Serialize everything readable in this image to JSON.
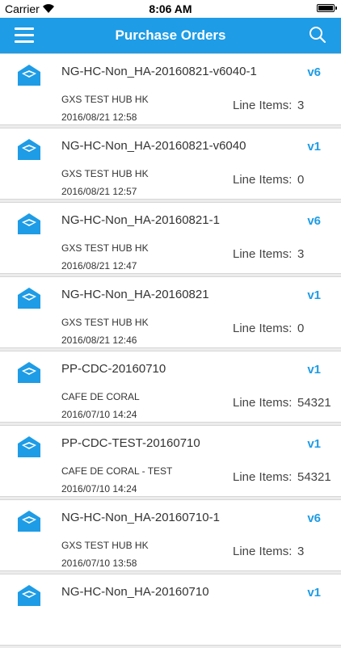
{
  "status_bar": {
    "carrier": "Carrier",
    "time": "8:06 AM"
  },
  "nav": {
    "title": "Purchase Orders",
    "menu_icon": "hamburger-menu-icon",
    "search_icon": "search-icon"
  },
  "theme": {
    "accent": "#1e9ce6",
    "background": "#ececec"
  },
  "line_items_label": "Line Items:",
  "orders": [
    {
      "name": "NG-HC-Non_HA-20160821-v6040-1",
      "version": "v6",
      "partner": "GXS TEST HUB HK",
      "date": "2016/08/21 12:58",
      "line_items": "3"
    },
    {
      "name": "NG-HC-Non_HA-20160821-v6040",
      "version": "v1",
      "partner": "GXS TEST HUB HK",
      "date": "2016/08/21 12:57",
      "line_items": "0"
    },
    {
      "name": "NG-HC-Non_HA-20160821-1",
      "version": "v6",
      "partner": "GXS TEST HUB HK",
      "date": "2016/08/21 12:47",
      "line_items": "3"
    },
    {
      "name": "NG-HC-Non_HA-20160821",
      "version": "v1",
      "partner": "GXS TEST HUB HK",
      "date": "2016/08/21 12:46",
      "line_items": "0"
    },
    {
      "name": "PP-CDC-20160710",
      "version": "v1",
      "partner": "CAFE DE CORAL",
      "date": "2016/07/10 14:24",
      "line_items": "54321"
    },
    {
      "name": "PP-CDC-TEST-20160710",
      "version": "v1",
      "partner": "CAFE DE CORAL - TEST",
      "date": "2016/07/10 14:24",
      "line_items": "54321"
    },
    {
      "name": "NG-HC-Non_HA-20160710-1",
      "version": "v6",
      "partner": "GXS TEST HUB HK",
      "date": "2016/07/10 13:58",
      "line_items": "3"
    },
    {
      "name": "NG-HC-Non_HA-20160710",
      "version": "v1",
      "partner": "",
      "date": "",
      "line_items": ""
    }
  ]
}
